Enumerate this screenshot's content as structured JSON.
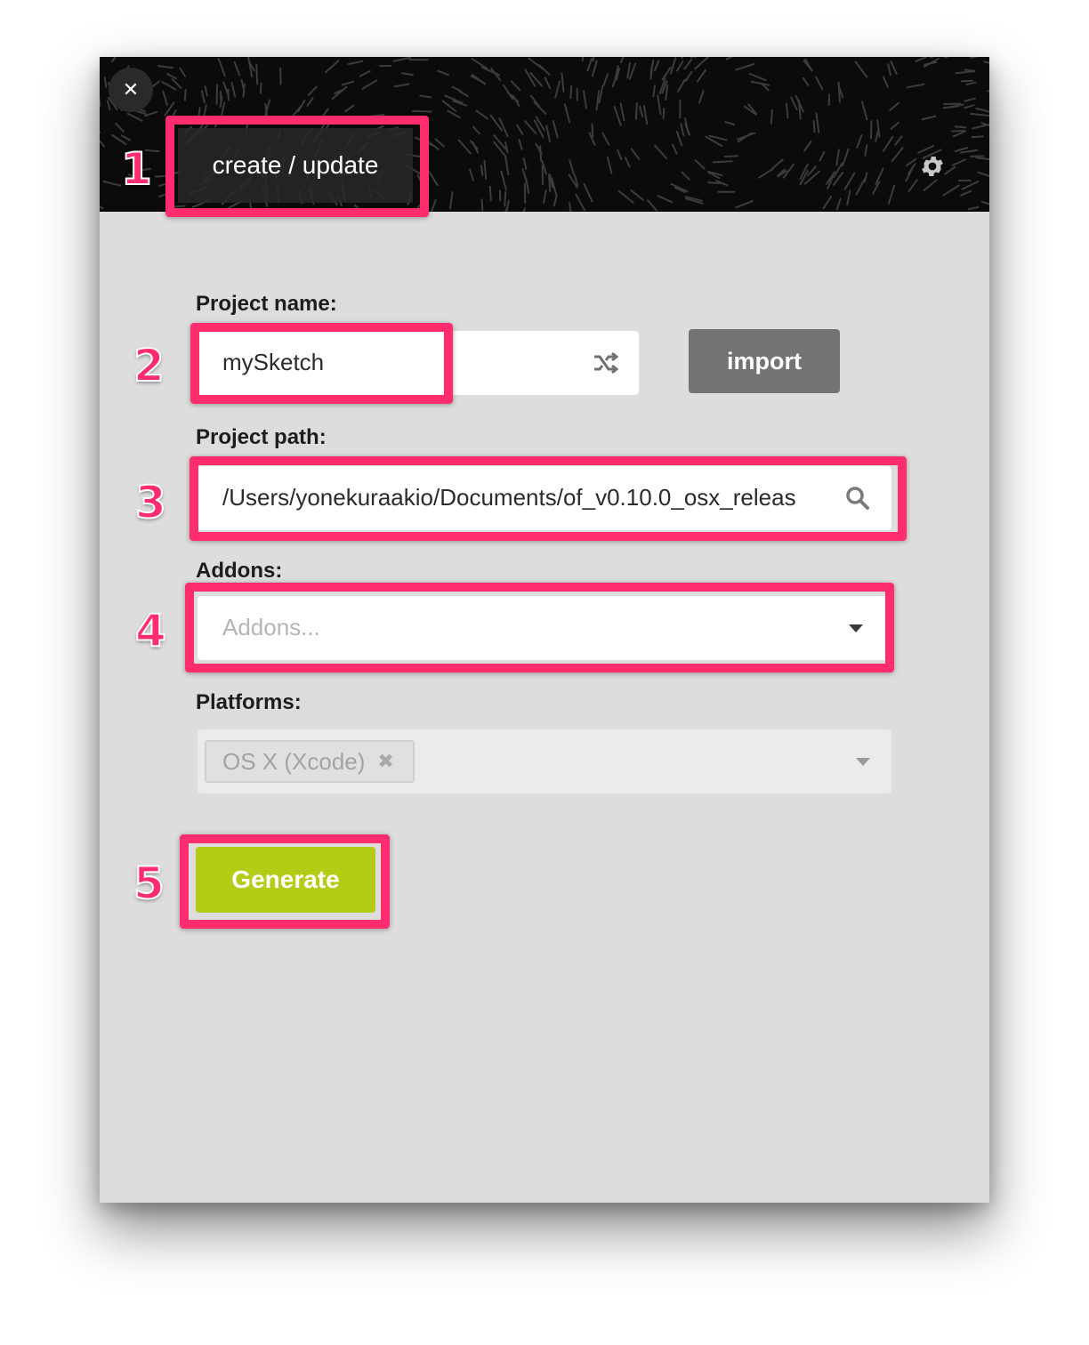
{
  "window": {
    "close_label": "✕",
    "tab_label": "create / update",
    "settings_icon": "gear-icon"
  },
  "form": {
    "project_name_label": "Project name:",
    "project_name_value": "mySketch",
    "shuffle_icon": "shuffle-icon",
    "import_label": "import",
    "project_path_label": "Project path:",
    "project_path_value": "/Users/yonekuraakio/Documents/of_v0.10.0_osx_releas",
    "search_icon": "search-icon",
    "addons_label": "Addons:",
    "addons_placeholder": "Addons...",
    "platforms_label": "Platforms:",
    "platform_selected": "OS X (Xcode)",
    "platform_remove": "✖",
    "generate_label": "Generate"
  },
  "annotations": {
    "step_1": "1",
    "step_2": "2",
    "step_3": "3",
    "step_4": "4",
    "step_5": "5",
    "highlight_color": "#ff2d6e"
  },
  "colors": {
    "generate": "#b4cc16",
    "import": "#737373",
    "body_bg": "#dddddd",
    "header_bg": "#0b0b0b"
  }
}
